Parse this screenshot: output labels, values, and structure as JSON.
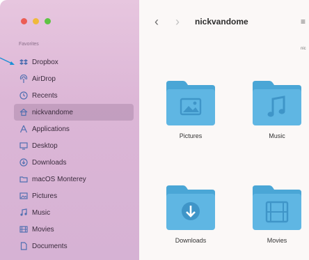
{
  "sidebar": {
    "section_title": "Favorites",
    "items": [
      {
        "label": "Dropbox",
        "icon": "dropbox-icon"
      },
      {
        "label": "AirDrop",
        "icon": "airdrop-icon"
      },
      {
        "label": "Recents",
        "icon": "clock-icon"
      },
      {
        "label": "nickvandome",
        "icon": "home-icon",
        "selected": true
      },
      {
        "label": "Applications",
        "icon": "applications-icon"
      },
      {
        "label": "Desktop",
        "icon": "desktop-icon"
      },
      {
        "label": "Downloads",
        "icon": "download-icon"
      },
      {
        "label": "macOS Monterey",
        "icon": "folder-icon"
      },
      {
        "label": "Pictures",
        "icon": "pictures-icon"
      },
      {
        "label": "Music",
        "icon": "music-icon"
      },
      {
        "label": "Movies",
        "icon": "movies-icon"
      },
      {
        "label": "Documents",
        "icon": "document-icon"
      }
    ]
  },
  "toolbar": {
    "back": "‹",
    "forward": "›",
    "title": "nickvandome",
    "right_icon": "≡",
    "right_small": "nic"
  },
  "files": [
    {
      "label": "Pictures",
      "icon": "pictures-folder-icon"
    },
    {
      "label": "Music",
      "icon": "music-folder-icon"
    },
    {
      "label": "Downloads",
      "icon": "downloads-folder-icon"
    },
    {
      "label": "Movies",
      "icon": "movies-folder-icon"
    }
  ],
  "colors": {
    "folder_blue": "#5fb6e3",
    "folder_tab": "#4aa6d6",
    "sidebar_icon": "#4f6fb0"
  }
}
